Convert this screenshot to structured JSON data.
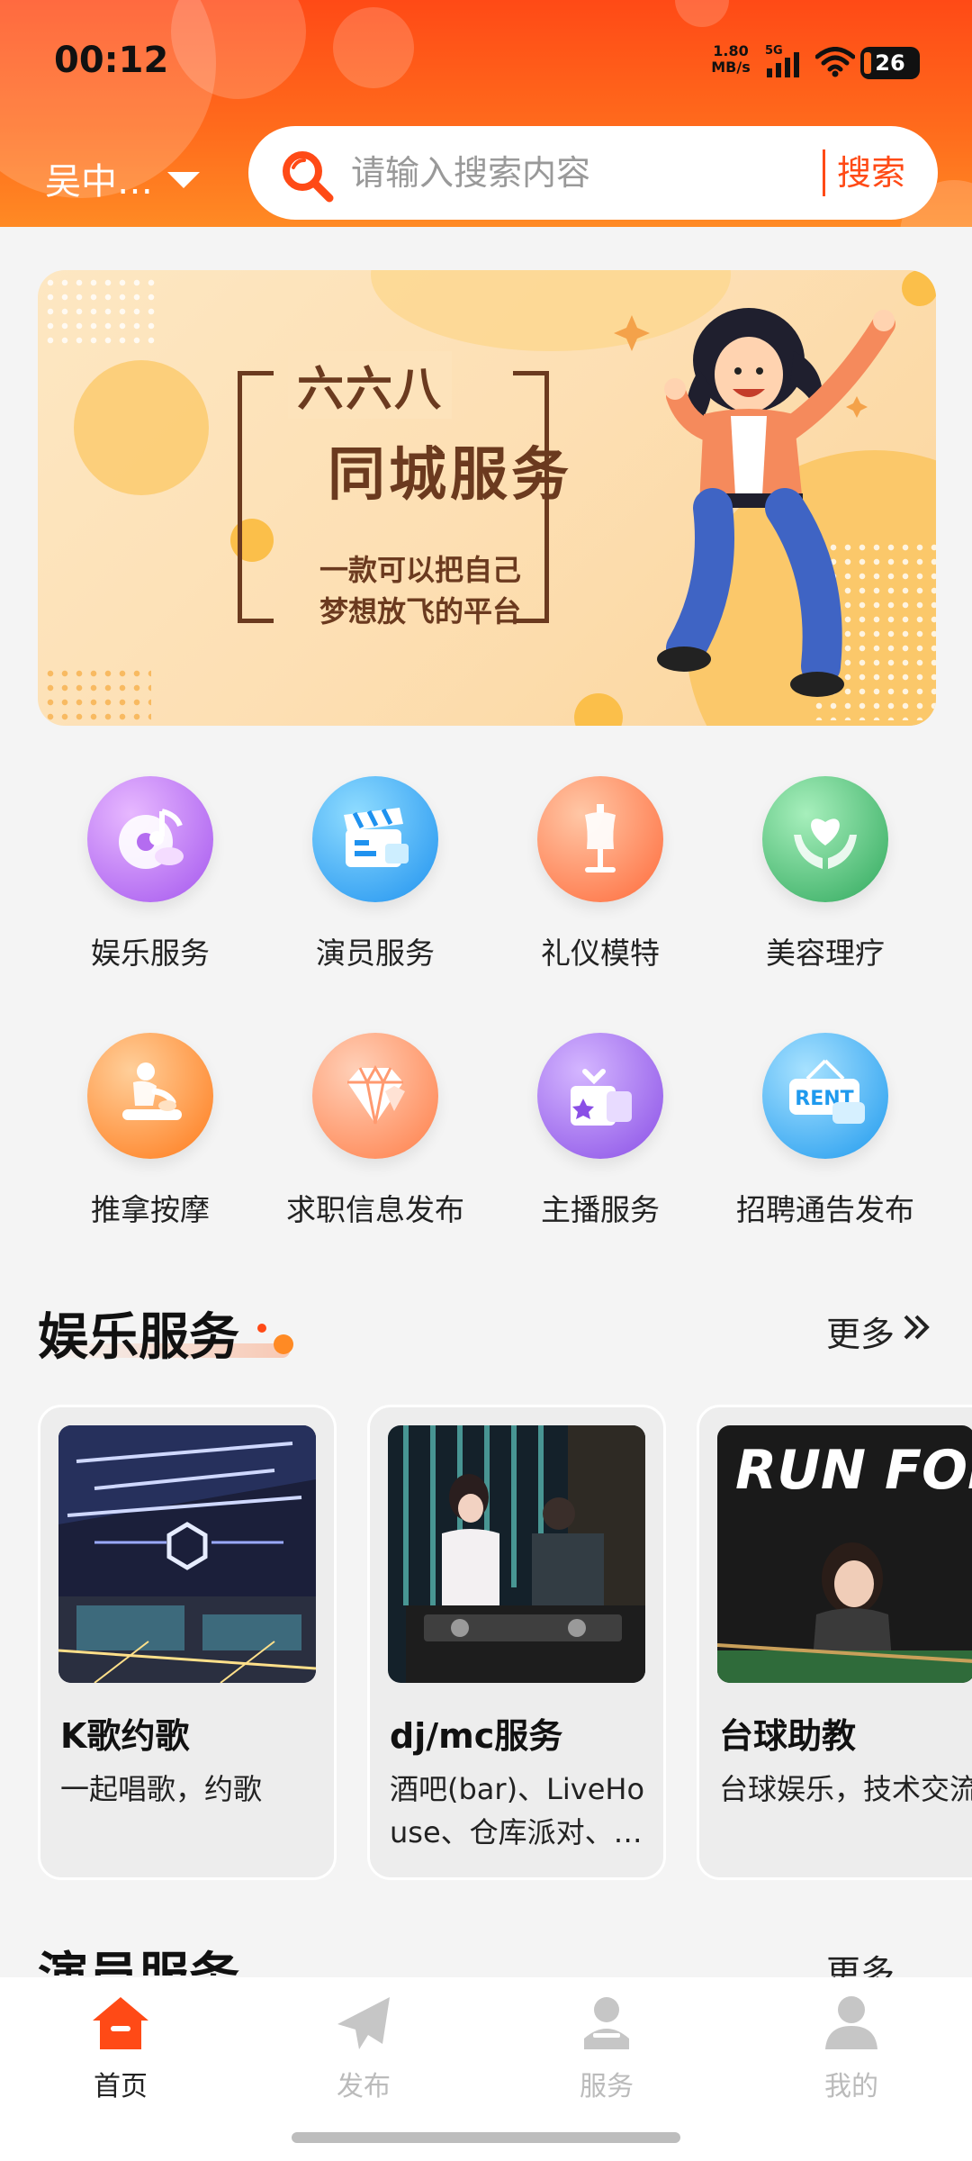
{
  "status_bar": {
    "time": "00:12",
    "net_speed_value": "1.80",
    "net_speed_unit": "MB/s",
    "network": "5G",
    "battery": "26"
  },
  "header": {
    "location": "吴中…",
    "search_placeholder": "请输入搜索内容",
    "search_button": "搜索"
  },
  "banner": {
    "brand": "六六八",
    "title": "同城服务",
    "subtitle_line1": "一款可以把自己",
    "subtitle_line2": "梦想放飞的平台"
  },
  "categories": [
    {
      "label": "娱乐服务",
      "icon": "music-disc-icon",
      "color": "#b46cf0"
    },
    {
      "label": "演员服务",
      "icon": "clapperboard-icon",
      "color": "#2fa8f5"
    },
    {
      "label": "礼仪模特",
      "icon": "mannequin-icon",
      "color": "#ff7a4a"
    },
    {
      "label": "美容理疗",
      "icon": "heart-hands-icon",
      "color": "#3fb56a"
    },
    {
      "label": "推拿按摩",
      "icon": "massage-icon",
      "color": "#ff8a2c"
    },
    {
      "label": "求职信息发布",
      "icon": "diamond-icon",
      "color": "#ff8f5a"
    },
    {
      "label": "主播服务",
      "icon": "gift-box-icon",
      "color": "#9a62e8"
    },
    {
      "label": "招聘通告发布",
      "icon": "rent-sign-icon",
      "color": "#2ea6f2"
    }
  ],
  "section_entertainment": {
    "title": "娱乐服务",
    "more": "更多",
    "cards": [
      {
        "title": "K歌约歌",
        "desc": "一起唱歌，约歌"
      },
      {
        "title": "dj/mc服务",
        "desc": "酒吧(bar)、LiveHouse、仓库派对、…"
      },
      {
        "title": "台球助教",
        "desc": "台球娱乐，技术交流",
        "image_text": "RUN FOR YOUR GOAL"
      }
    ]
  },
  "section_actor": {
    "title": "演员服务",
    "more": "更多"
  },
  "bottom_nav": [
    {
      "label": "首页",
      "icon": "home-icon",
      "active": true
    },
    {
      "label": "发布",
      "icon": "paper-plane-icon",
      "active": false
    },
    {
      "label": "服务",
      "icon": "service-user-icon",
      "active": false
    },
    {
      "label": "我的",
      "icon": "profile-icon",
      "active": false
    }
  ],
  "colors": {
    "brand": "#ff4a16",
    "header_gradient_end": "#ff8a24",
    "page_background": "#f4f4f4"
  }
}
